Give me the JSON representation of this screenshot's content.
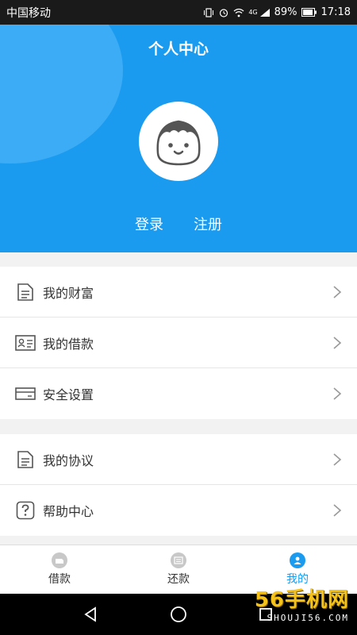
{
  "status_bar": {
    "carrier": "中国移动",
    "network": "4G",
    "battery": "89%",
    "time": "17:18"
  },
  "header": {
    "title": "个人中心",
    "login": "登录",
    "register": "注册",
    "avatar_icon": "face-avatar-icon"
  },
  "menu_group_1": [
    {
      "label": "我的财富",
      "icon": "document-icon"
    },
    {
      "label": "我的借款",
      "icon": "id-card-icon"
    },
    {
      "label": "安全设置",
      "icon": "card-icon"
    }
  ],
  "menu_group_2": [
    {
      "label": "我的协议",
      "icon": "document-icon"
    },
    {
      "label": "帮助中心",
      "icon": "help-icon"
    }
  ],
  "bottom_nav": {
    "tabs": [
      {
        "label": "借款",
        "icon": "loan-icon",
        "active": false
      },
      {
        "label": "还款",
        "icon": "repay-icon",
        "active": false
      },
      {
        "label": "我的",
        "icon": "person-icon",
        "active": true
      }
    ]
  },
  "watermark": {
    "big": "56手机网",
    "small": "SHOUJI56.COM"
  },
  "colors": {
    "primary": "#1a9bf0",
    "primary_light": "#3bacf5",
    "text": "#333333",
    "background": "#f2f2f2"
  }
}
